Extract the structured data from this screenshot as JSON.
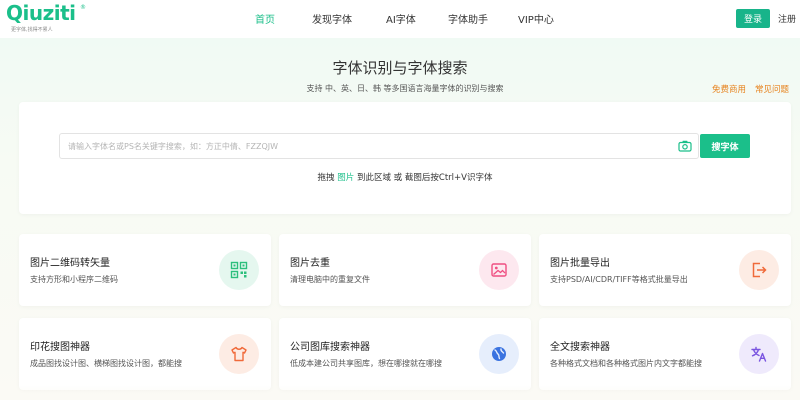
{
  "header": {
    "logo_text": "Qiuziti",
    "logo_reg": "®",
    "logo_slogan": "更字体,找得不累人",
    "nav": [
      "首页",
      "发现字体",
      "AI字体",
      "字体助手",
      "VIP中心"
    ],
    "login_label": "登录",
    "register_label": "注册"
  },
  "hero": {
    "title": "字体识别与字体搜索",
    "subtitle": "支持 中、英、日、韩 等多国语言海量字体的识别与搜索",
    "free_link": "免费商用",
    "faq_link": "常见问题"
  },
  "search": {
    "placeholder": "请输入字体名或PS名关键字搜索，如：方正中倩、FZZQJW",
    "button_label": "搜字体",
    "hint_prefix": "拖拽",
    "hint_highlight": "图片",
    "hint_suffix": "到此区域 或 截图后按Ctrl+V识字体"
  },
  "tools": [
    {
      "title": "图片二维码转矢量",
      "desc": "支持方形和小程序二维码",
      "icon": "qrcode-icon",
      "bg": "#e5f7ef",
      "fg": "#2cbf7c"
    },
    {
      "title": "图片去重",
      "desc": "清理电脑中的重复文件",
      "icon": "image-icon",
      "bg": "#fde8ef",
      "fg": "#ef4f82"
    },
    {
      "title": "图片批量导出",
      "desc": "支持PSD/AI/CDR/TIFF等格式批量导出",
      "icon": "export-icon",
      "bg": "#fdece4",
      "fg": "#f06a3a"
    },
    {
      "title": "印花搜图神器",
      "desc": "成品图找设计图、横梯图找设计图，都能搜",
      "icon": "shirt-icon",
      "bg": "#fdece4",
      "fg": "#f06a3a"
    },
    {
      "title": "公司图库搜索神器",
      "desc": "低成本建公司共享图库，想在哪搜就在哪搜",
      "icon": "globe-icon",
      "bg": "#e6eefc",
      "fg": "#3b73e0"
    },
    {
      "title": "全文搜索神器",
      "desc": "各种格式文档和各种格式图片内文字都能搜",
      "icon": "translate-icon",
      "bg": "#efeafc",
      "fg": "#7a55e0"
    }
  ],
  "colors": {
    "accent": "#1bbf8a",
    "orange": "#e7821d"
  }
}
